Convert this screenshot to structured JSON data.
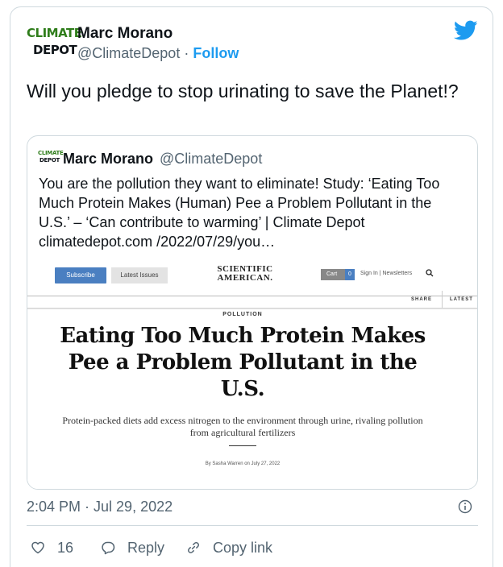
{
  "colors": {
    "accent": "#1d9bf0",
    "secondary_text": "#536471",
    "border": "#cfd9de",
    "logo_green": "#2f7d1b",
    "logo_gold": "#d9a21b"
  },
  "author": {
    "logo_line1": "CLIMATE",
    "logo_line2": "DEPOT",
    "name": "Marc Morano",
    "handle": "@ClimateDepot",
    "separator": " · ",
    "follow_label": "Follow"
  },
  "tweet": {
    "text": "Will you pledge to stop urinating to save the Planet!?"
  },
  "quote": {
    "logo_line1": "CLIMATE",
    "logo_line2": "DEPOT",
    "name": "Marc Morano",
    "handle": "@ClimateDepot",
    "text": "You are the pollution they want to eliminate! Study: ‘Eating Too Much Protein Makes (Human) Pee a Problem Pollutant in the U.S.’ – ‘Can contribute to warming’ | Climate Depot climatedepot.com /2022/07/29/you…"
  },
  "article_preview": {
    "subscribe_label": "Subscribe",
    "latest_issues_label": "Latest Issues",
    "site_logo": "SCIENTIFIC AMERICAN.",
    "cart_label": "Cart",
    "cart_count": "0",
    "account_links": "Sign In  |  Newsletters",
    "share_label": "SHARE",
    "latest_label": "LATEST",
    "kicker": "POLLUTION",
    "headline": "Eating Too Much Protein Makes Pee a Problem Pollutant in the U.S.",
    "dek": "Protein-packed diets add excess nitrogen to the environment through urine, rivaling pollution from agricultural fertilizers",
    "byline": "By Sasha Warren on July 27, 2022"
  },
  "footer": {
    "timestamp": "2:04 PM · Jul 29, 2022",
    "like_count": "16",
    "reply_label": "Reply",
    "copy_link_label": "Copy link"
  },
  "icons": {
    "brand": "twitter-bird-icon",
    "info": "info-icon",
    "like": "heart-icon",
    "reply": "speech-bubble-icon",
    "copy": "link-icon",
    "search": "search-icon"
  }
}
